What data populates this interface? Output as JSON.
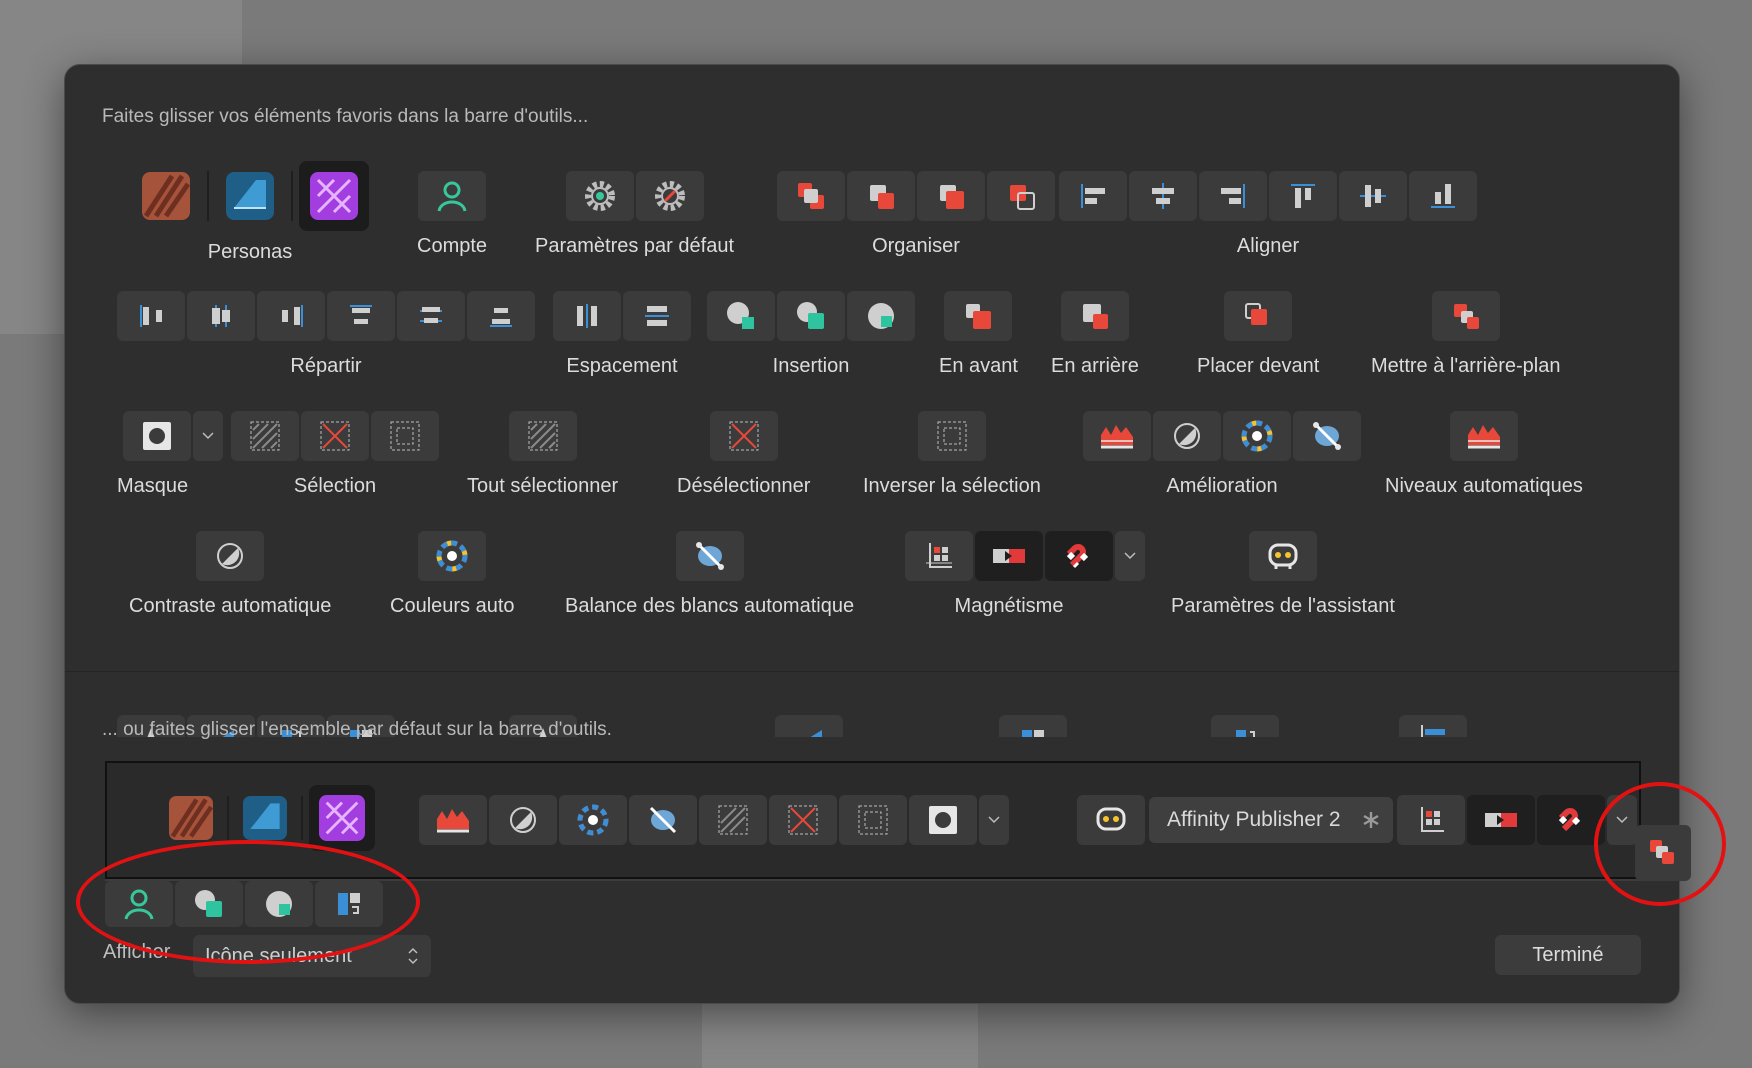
{
  "instructions": {
    "top": "Faites glisser vos éléments favoris dans la barre d'outils...",
    "bottom": "... ou faites glisser l'ensemble par défaut sur la barre d'outils."
  },
  "groups": {
    "personas": "Personas",
    "compte": "Compte",
    "parametres_defaut": "Paramètres par défaut",
    "organiser": "Organiser",
    "aligner": "Aligner",
    "repartir": "Répartir",
    "espacement": "Espacement",
    "insertion": "Insertion",
    "en_avant": "En avant",
    "en_arriere": "En arrière",
    "placer_devant": "Placer devant",
    "arriere_plan": "Mettre à l'arrière-plan",
    "masque": "Masque",
    "selection": "Sélection",
    "tout_selectionner": "Tout sélectionner",
    "deselectionner": "Désélectionner",
    "inverser": "Inverser la sélection",
    "amelioration": "Amélioration",
    "niveaux_auto": "Niveaux automatiques",
    "contraste_auto": "Contraste automatique",
    "couleurs_auto": "Couleurs auto",
    "balance_blancs": "Balance des blancs automatique",
    "magnetisme": "Magnétisme",
    "assistant": "Paramètres de l'assistant"
  },
  "default_set": {
    "document_name": "Affinity Publisher 2"
  },
  "footer": {
    "show_label": "Afficher",
    "show_value": "Icône seulement",
    "done_button": "Terminé"
  },
  "colors": {
    "accent_red": "#e8483a",
    "accent_blue": "#3a8fd6",
    "accent_green": "#2ec4a0",
    "annotation": "#e31212"
  }
}
